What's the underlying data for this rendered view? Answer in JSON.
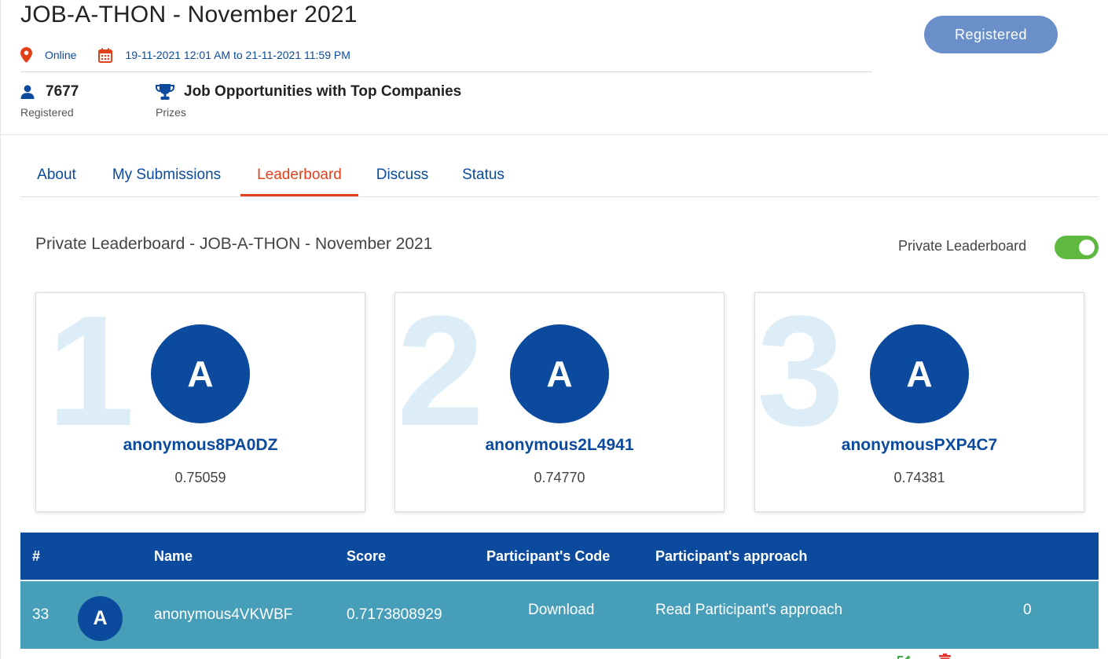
{
  "event": {
    "title": "JOB-A-THON - November 2021",
    "location": "Online",
    "dates": "19-11-2021 12:01 AM to 21-11-2021 11:59 PM",
    "registered_count": "7677",
    "registered_label": "Registered",
    "prize_text": "Job Opportunities with Top Companies",
    "prize_label": "Prizes",
    "status_button": "Registered"
  },
  "tabs": [
    {
      "label": "About",
      "active": false
    },
    {
      "label": "My Submissions",
      "active": false
    },
    {
      "label": "Leaderboard",
      "active": true
    },
    {
      "label": "Discuss",
      "active": false
    },
    {
      "label": "Status",
      "active": false
    }
  ],
  "leaderboard": {
    "title": "Private Leaderboard - JOB-A-THON - November 2021",
    "toggle_label": "Private Leaderboard",
    "toggle_on": true,
    "podium": [
      {
        "rank": "1",
        "initial": "A",
        "name": "anonymous8PA0DZ",
        "score": "0.75059"
      },
      {
        "rank": "2",
        "initial": "A",
        "name": "anonymous2L4941",
        "score": "0.74770"
      },
      {
        "rank": "3",
        "initial": "A",
        "name": "anonymousPXP4C7",
        "score": "0.74381"
      }
    ],
    "columns": {
      "rank": "#",
      "name": "Name",
      "score": "Score",
      "code": "Participant's Code",
      "approach": "Participant's approach"
    },
    "rows": [
      {
        "rank": "33",
        "initial": "A",
        "name": "anonymous4VKWBF",
        "score": "0.7173808929",
        "code_action": "Download",
        "approach_action": "Read Participant's approach",
        "likes": "0"
      }
    ]
  },
  "colors": {
    "brand_blue": "#0b4a9c",
    "accent_red": "#e2401b",
    "row_teal": "#479eb8",
    "toggle_green": "#5fb83f",
    "button_blue": "#6a8fc9"
  },
  "icons": [
    "location-pin-icon",
    "calendar-icon",
    "user-icon",
    "trophy-icon",
    "download-icon",
    "link-icon",
    "edit-icon",
    "trash-icon",
    "thumbs-up-icon"
  ]
}
